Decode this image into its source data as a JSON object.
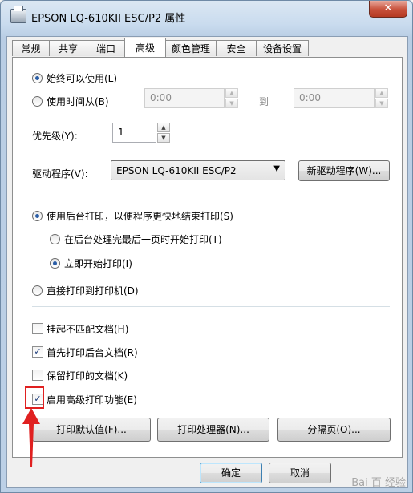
{
  "window": {
    "title": "EPSON LQ-610KII ESC/P2 属性",
    "close_symbol": "✕"
  },
  "tabs": [
    {
      "label": "常规",
      "active": false
    },
    {
      "label": "共享",
      "active": false
    },
    {
      "label": "端口",
      "active": false
    },
    {
      "label": "高级",
      "active": true
    },
    {
      "label": "颜色管理",
      "active": false
    },
    {
      "label": "安全",
      "active": false
    },
    {
      "label": "设备设置",
      "active": false
    }
  ],
  "availability": {
    "always_label": "始终可以使用(L)",
    "always_selected": true,
    "from_label": "使用时间从(B)",
    "from_selected": false,
    "from_value": "0:00",
    "to_label": "到",
    "to_value": "0:00"
  },
  "priority": {
    "label": "优先级(Y):",
    "value": "1"
  },
  "driver": {
    "label": "驱动程序(V):",
    "selected": "EPSON LQ-610KII ESC/P2",
    "new_driver_button": "新驱动程序(W)..."
  },
  "spool": {
    "use_spool_label": "使用后台打印，以便程序更快地结束打印(S)",
    "use_spool_selected": true,
    "after_last_page_label": "在后台处理完最后一页时开始打印(T)",
    "after_last_page_selected": false,
    "immediately_label": "立即开始打印(I)",
    "immediately_selected": true,
    "direct_label": "直接打印到打印机(D)",
    "direct_selected": false
  },
  "checkboxes": [
    {
      "label": "挂起不匹配文档(H)",
      "checked": false
    },
    {
      "label": "首先打印后台文档(R)",
      "checked": true
    },
    {
      "label": "保留打印的文档(K)",
      "checked": false
    },
    {
      "label": "启用高级打印功能(E)",
      "checked": true
    }
  ],
  "bottom_buttons": {
    "defaults": "打印默认值(F)...",
    "processor": "打印处理器(N)...",
    "separator": "分隔页(O)..."
  },
  "dialog_buttons": {
    "ok": "确定",
    "cancel": "取消"
  },
  "watermark": "Bai 百 经验",
  "colors": {
    "annotation_red": "#e02020",
    "radio_dot": "#2a5da6"
  }
}
